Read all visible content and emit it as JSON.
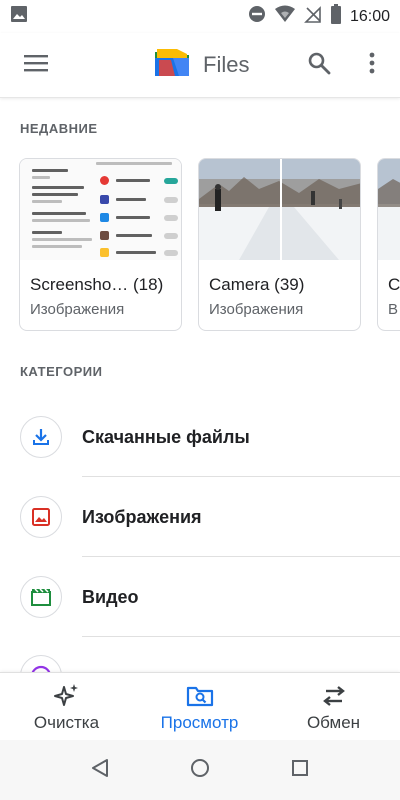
{
  "status_bar": {
    "time": "16:00",
    "icons": [
      "image-icon",
      "do-not-disturb-icon",
      "wifi-icon",
      "no-signal-icon",
      "battery-icon"
    ]
  },
  "app_bar": {
    "title": "Files",
    "icons": [
      "menu-icon",
      "files-logo-icon",
      "search-icon",
      "more-vert-icon"
    ]
  },
  "recent": {
    "header": "НЕДАВНИЕ",
    "cards": [
      {
        "title": "Screensho… (18)",
        "subtitle": "Изображения",
        "thumb": "screenshot-thumbnail"
      },
      {
        "title": "Camera (39)",
        "subtitle": "Изображения",
        "thumb": "camera-thumbnail"
      },
      {
        "title": "C",
        "subtitle": "В",
        "thumb": "photo-thumbnail"
      }
    ]
  },
  "categories": {
    "header": "КАТЕГОРИИ",
    "items": [
      {
        "label": "Скачанные файлы",
        "icon": "download-icon",
        "color": "#1a73e8"
      },
      {
        "label": "Изображения",
        "icon": "image-icon",
        "color": "#d93025"
      },
      {
        "label": "Видео",
        "icon": "video-icon",
        "color": "#1e8e3e"
      }
    ],
    "partial_item_icon_color": "#9334e6"
  },
  "bottom_nav": {
    "items": [
      {
        "label": "Очистка",
        "icon": "sparkle-icon",
        "active": false
      },
      {
        "label": "Просмотр",
        "icon": "browse-icon",
        "active": true
      },
      {
        "label": "Обмен",
        "icon": "swap-icon",
        "active": false
      }
    ],
    "active_color": "#1a73e8"
  },
  "system_nav": {
    "icons": [
      "back-icon",
      "home-icon",
      "recents-icon"
    ]
  }
}
